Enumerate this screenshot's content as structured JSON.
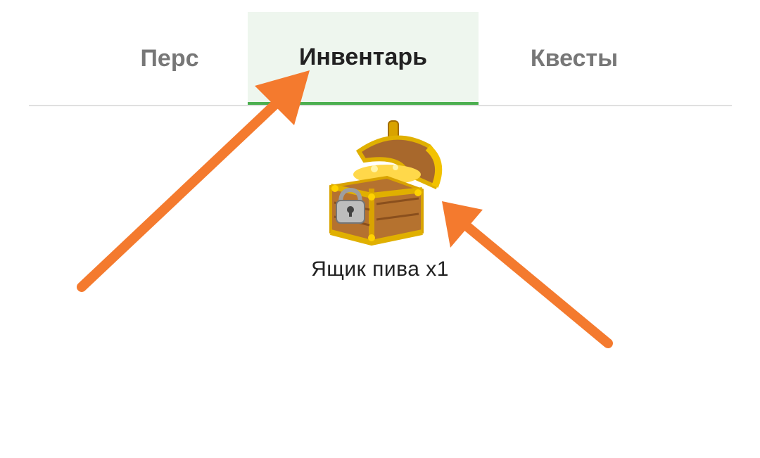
{
  "tabs": [
    {
      "label": "Перс",
      "active": false
    },
    {
      "label": "Инвентарь",
      "active": true
    },
    {
      "label": "Квесты",
      "active": false
    }
  ],
  "inventory": {
    "items": [
      {
        "icon": "treasure-chest-icon",
        "label": "Ящик пива x1"
      }
    ]
  },
  "colors": {
    "active_tab_bg": "#eef6ee",
    "active_tab_underline": "#4caf50",
    "annotation_arrow": "#f47a2e"
  }
}
